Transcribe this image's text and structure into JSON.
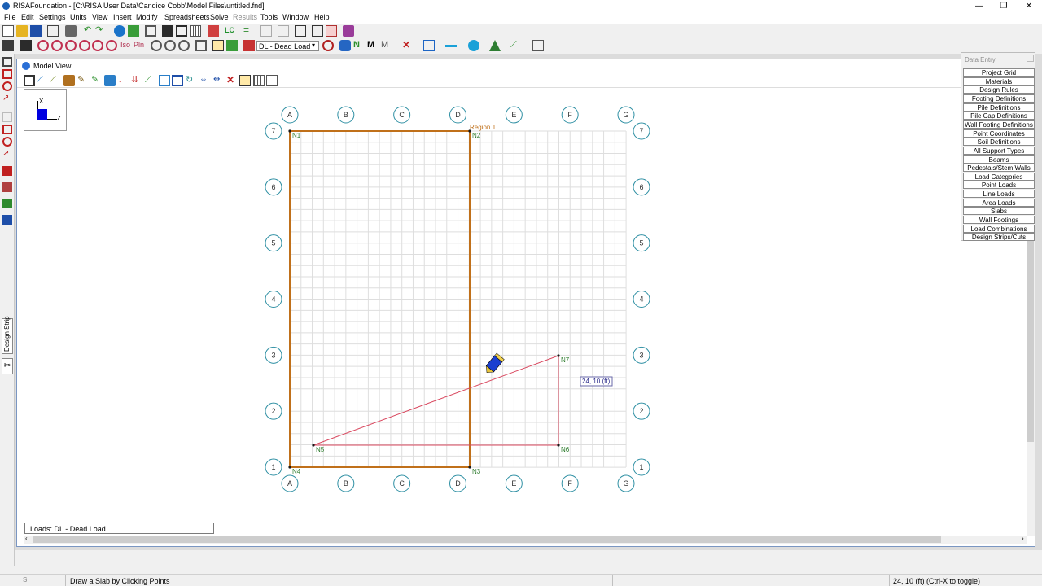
{
  "app": {
    "title": "RISAFoundation - [C:\\RISA User Data\\Candice Cobb\\Model Files\\untitled.fnd]",
    "window_buttons": [
      "—",
      "❐",
      "✕"
    ]
  },
  "menu": [
    "File",
    "Edit",
    "Settings",
    "Units",
    "View",
    "Insert",
    "Modify",
    "Spreadsheets",
    "Solve",
    "Results",
    "Tools",
    "Window",
    "Help"
  ],
  "menu_disabled": [
    "Results"
  ],
  "toolbar2": {
    "iso_label": "Iso",
    "pln_label": "Pln",
    "lc_label": "LC",
    "load_case_select": "DL - Dead Load"
  },
  "model_view": {
    "title": "Model View",
    "axis_x": "X",
    "axis_z": "Z",
    "loads_label": "Loads: DL - Dead Load"
  },
  "grid": {
    "columns": [
      "A",
      "B",
      "C",
      "D",
      "E",
      "F",
      "G"
    ],
    "rows": [
      "7",
      "6",
      "5",
      "4",
      "3",
      "2",
      "1"
    ]
  },
  "nodes": [
    {
      "label": "N1",
      "color": "#2f7d2f"
    },
    {
      "label": "N2",
      "color": "#2f7d2f"
    },
    {
      "label": "N3",
      "color": "#2f7d2f"
    },
    {
      "label": "N4",
      "color": "#2f7d2f"
    },
    {
      "label": "N5",
      "color": "#2f7d2f"
    },
    {
      "label": "N6",
      "color": "#2f7d2f"
    },
    {
      "label": "N7",
      "color": "#2f7d2f"
    }
  ],
  "region_label": "Region 1",
  "cursor_tooltip": "24, 10 (ft)",
  "data_entry": {
    "title": "Data Entry",
    "buttons": [
      "Project Grid",
      "Materials",
      "Design Rules",
      "Footing Definitions",
      "Pile Definitions",
      "Pile Cap Definitions",
      "Wall Footing Definitions",
      "Point Coordinates",
      "Soil Definitions",
      "All Support Types",
      "Beams",
      "Pedestals/Stem Walls",
      "Load Categories",
      "Point Loads",
      "Line Loads",
      "Area Loads",
      "Slabs",
      "Wall Footings",
      "Load Combinations",
      "Design Strips/Cuts"
    ]
  },
  "left_tabs": {
    "design_strip": "Design Strip"
  },
  "status": {
    "message": "Draw a Slab by Clicking Points",
    "coords": "24, 10 (ft)   (Ctrl-X to toggle)"
  },
  "colors": {
    "region": "#c0701a",
    "slab_line": "#d9485f",
    "grid_bubble": "#2e8fa3",
    "node_label": "#2f7d2f"
  }
}
